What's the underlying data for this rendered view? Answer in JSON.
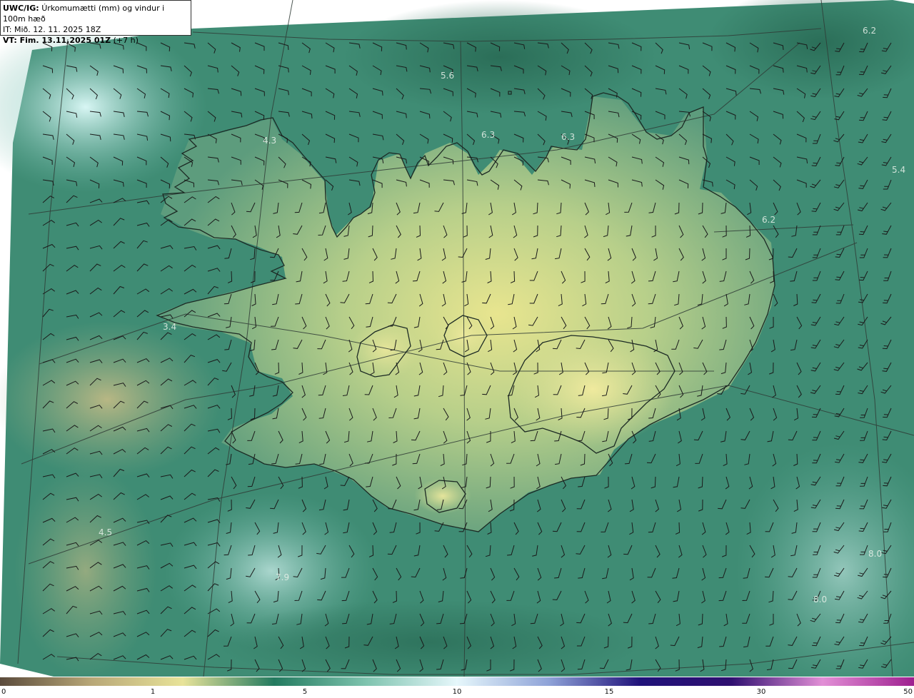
{
  "header": {
    "model": "UWC/IG:",
    "parameter": "Úrkomumætti (mm) og vindur i 100m hæð",
    "it_line": "IT: Mið. 12. 11. 2025 18Z",
    "vt_label": "VT: Fim. 13.11.2025 01Z",
    "vt_lead": "(+7 h)"
  },
  "map": {
    "point_values": [
      "6.2",
      "5.6",
      "6.3",
      "6.3",
      "4.3",
      "5.4",
      "6.2",
      "3.4",
      "4.5",
      "7.9",
      "8.0",
      "8.0"
    ],
    "coast_color": "#1c2a24",
    "graticule_color": "#2f3b36",
    "barb_color": "#1a1a1a"
  },
  "colorbar": {
    "ticks": [
      "0",
      "1",
      "5",
      "10",
      "15",
      "30",
      "50"
    ],
    "colors": [
      "#5b4b3c",
      "#b8a777",
      "#e8e399",
      "#237a5f",
      "#7ec3ae",
      "#e6f7fb",
      "#8fa3d8",
      "#20127a",
      "#2f0f70",
      "#e28fd6",
      "#9e1f8f"
    ]
  }
}
